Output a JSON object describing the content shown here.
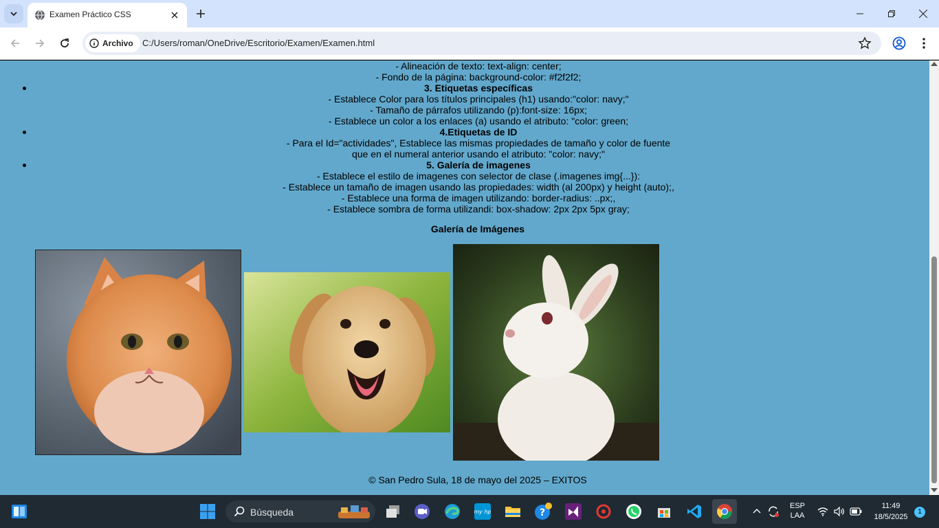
{
  "browser": {
    "tab_title": "Examen Práctico CSS",
    "chip_label": "Archivo",
    "url": "C:/Users/roman/OneDrive/Escritorio/Examen/Examen.html"
  },
  "page": {
    "items": [
      {
        "lines": [
          "- Alineación de texto: text-align: center;",
          "- Fondo de la página: background-color: #f2f2f2;"
        ]
      },
      {
        "heading": "3. Etiquetas específicas",
        "lines": [
          "- Establece Color para los títulos principales (h1) usando:\"color: navy;\"",
          "- Tamaño de párrafos utilizando (p):font-size: 16px;",
          "- Establece un color a los enlaces (a) usando el atributo: \"color: green;"
        ]
      },
      {
        "heading": "4.Etiquetas de ID",
        "lines": [
          "- Para el Id=\"actividades\", Establece las mismas propiedades de tamaño y color de fuente",
          "que en el numeral anterior usando el atributo: \"color: navy;\""
        ]
      },
      {
        "heading": "5. Galería de imagenes",
        "lines": [
          "- Establece el estilo de imagenes con selector de clase (.imagenes img{...}):",
          "- Establece un tamaño de imagen usando las propiedades: width (al 200px) y height (auto);,",
          "- Establece una forma de imagen utilizando: border-radius: ..px;,",
          "- Establece sombra de forma utilizandi: box-shadow: 2px 2px 5px gray;"
        ]
      }
    ],
    "gallery_title": "Galería de Imágenes",
    "footer": "© San Pedro Sula, 18 de mayo del 2025 – EXITOS"
  },
  "taskbar": {
    "search_label": "Búsqueda",
    "lang": "ESP",
    "layout": "LAA",
    "time": "11:49",
    "date": "18/5/2025",
    "notifications": "1"
  },
  "colors": {
    "page_bg": "#62a8cc",
    "titlebar": "#d3e3fd",
    "taskbar": "#1f2a33"
  }
}
